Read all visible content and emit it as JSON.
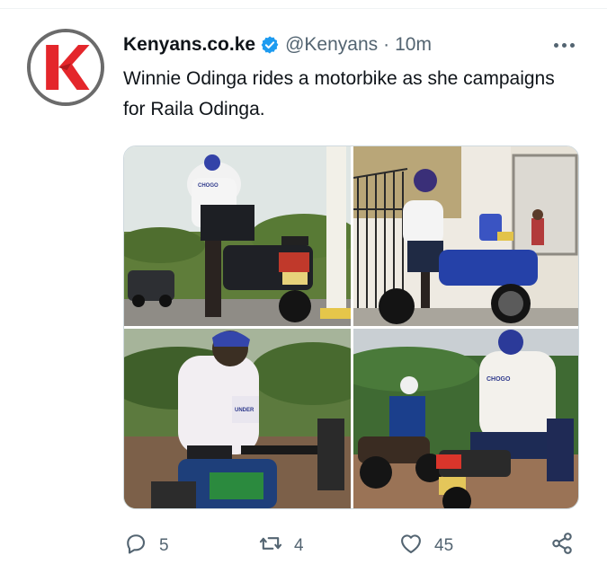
{
  "tweet": {
    "author_name": "Kenyans.co.ke",
    "handle": "@Kenyans",
    "separator": "·",
    "time": "10m",
    "text": "Winnie Odinga rides a motorbike as she campaigns for Raila Odinga.",
    "verified": true
  },
  "photos": [
    {
      "caption": "",
      "jersey_text": "CHOGO"
    },
    {
      "caption": ""
    },
    {
      "caption": "",
      "jersey_text": "UNDER"
    },
    {
      "caption": "",
      "jersey_text": "CHOGO"
    }
  ],
  "actions": {
    "reply": {
      "icon": "reply-icon",
      "count": "5"
    },
    "retweet": {
      "icon": "retweet-icon",
      "count": "4"
    },
    "like": {
      "icon": "heart-icon",
      "count": "45"
    },
    "share": {
      "icon": "share-icon"
    }
  },
  "colors": {
    "verified_blue": "#1d9bf0",
    "brand_red": "#e4262b",
    "text_secondary": "#536471"
  }
}
